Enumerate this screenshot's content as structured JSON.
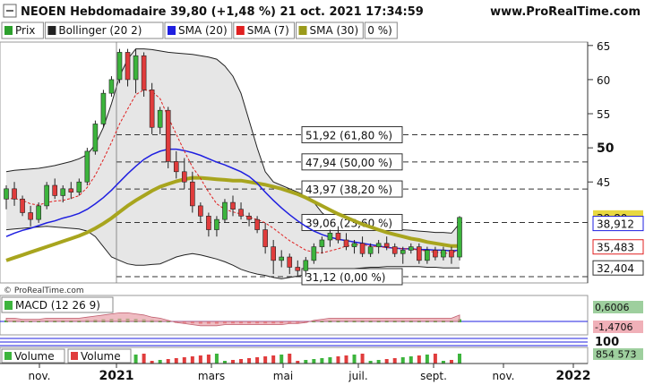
{
  "header": {
    "title": "NEOEN Hebdomadaire 39,80 (+1,48 %) 21 oct. 2021 17:34:59",
    "site": "www.ProRealTime.com",
    "icon": "minus-box-icon"
  },
  "legend": [
    {
      "label": "Prix",
      "color": "#2ca02c"
    },
    {
      "label": "Bollinger (20 2)",
      "color": "#222222"
    },
    {
      "label": "SMA (20)",
      "color": "#1f1fe0"
    },
    {
      "label": "SMA (7)",
      "color": "#e02020"
    },
    {
      "label": "SMA (30)",
      "color": "#9a9a1a"
    }
  ],
  "legend_extra": "0 %)",
  "copyright": "© ProRealTime.com",
  "colors": {
    "up": "#3cb43c",
    "down": "#e03c3c",
    "bollinger": "#222222",
    "bollinger_fill": "#e6e6e6",
    "sma20": "#1f1fe0",
    "sma7": "#e02020",
    "sma30": "#a8a51e",
    "macd_fill": "#e8a0a8",
    "last_price_bg": "#e8d840"
  },
  "chart_data": {
    "type": "candlestick",
    "x_tick_labels": [
      "nov.",
      "2021",
      "mars",
      "mai",
      "juil.",
      "sept.",
      "nov.",
      "2022"
    ],
    "y_tick_labels": [
      "65",
      "60",
      "55",
      "50",
      "45"
    ],
    "ylim": [
      30.2,
      65.5
    ],
    "last_price": "39,80",
    "price_tags": [
      "38,912",
      "35,483",
      "32,404"
    ],
    "fib_levels": [
      {
        "label": "51,92 (61,80 %)",
        "value": 51.92
      },
      {
        "label": "47,94 (50,00 %)",
        "value": 47.94
      },
      {
        "label": "43,97 (38,20 %)",
        "value": 43.97
      },
      {
        "label": "39,06 (23,60 %)",
        "value": 39.06
      },
      {
        "label": "31,12 (0,00 %)",
        "value": 31.12
      }
    ],
    "candles": [
      {
        "o": 42.5,
        "h": 44.5,
        "l": 41.0,
        "c": 44.0
      },
      {
        "o": 44.0,
        "h": 45.0,
        "l": 41.5,
        "c": 42.5
      },
      {
        "o": 42.5,
        "h": 43.0,
        "l": 40.0,
        "c": 40.5
      },
      {
        "o": 40.5,
        "h": 41.5,
        "l": 38.5,
        "c": 39.5
      },
      {
        "o": 39.5,
        "h": 42.0,
        "l": 39.0,
        "c": 41.5
      },
      {
        "o": 41.5,
        "h": 45.0,
        "l": 41.0,
        "c": 44.5
      },
      {
        "o": 44.5,
        "h": 45.5,
        "l": 42.5,
        "c": 43.0
      },
      {
        "o": 43.0,
        "h": 44.5,
        "l": 42.0,
        "c": 44.0
      },
      {
        "o": 44.0,
        "h": 45.0,
        "l": 42.5,
        "c": 43.5
      },
      {
        "o": 43.5,
        "h": 45.5,
        "l": 43.0,
        "c": 45.0
      },
      {
        "o": 45.0,
        "h": 50.0,
        "l": 44.5,
        "c": 49.5
      },
      {
        "o": 49.5,
        "h": 54.0,
        "l": 49.0,
        "c": 53.5
      },
      {
        "o": 53.5,
        "h": 58.5,
        "l": 53.0,
        "c": 58.0
      },
      {
        "o": 58.0,
        "h": 60.5,
        "l": 57.5,
        "c": 60.0
      },
      {
        "o": 60.0,
        "h": 64.5,
        "l": 59.5,
        "c": 64.0
      },
      {
        "o": 64.0,
        "h": 64.5,
        "l": 59.0,
        "c": 60.0
      },
      {
        "o": 60.0,
        "h": 64.5,
        "l": 58.0,
        "c": 63.5
      },
      {
        "o": 63.5,
        "h": 64.0,
        "l": 57.5,
        "c": 58.5
      },
      {
        "o": 58.5,
        "h": 59.5,
        "l": 52.0,
        "c": 53.0
      },
      {
        "o": 53.0,
        "h": 56.0,
        "l": 52.0,
        "c": 55.5
      },
      {
        "o": 55.5,
        "h": 56.0,
        "l": 47.0,
        "c": 48.0
      },
      {
        "o": 48.0,
        "h": 49.5,
        "l": 45.5,
        "c": 46.5
      },
      {
        "o": 46.5,
        "h": 48.5,
        "l": 44.0,
        "c": 45.0
      },
      {
        "o": 45.0,
        "h": 46.5,
        "l": 40.5,
        "c": 41.5
      },
      {
        "o": 41.5,
        "h": 42.0,
        "l": 39.0,
        "c": 40.0
      },
      {
        "o": 40.0,
        "h": 40.5,
        "l": 37.0,
        "c": 38.0
      },
      {
        "o": 38.0,
        "h": 40.0,
        "l": 37.0,
        "c": 39.5
      },
      {
        "o": 39.5,
        "h": 42.5,
        "l": 39.0,
        "c": 42.0
      },
      {
        "o": 42.0,
        "h": 43.0,
        "l": 40.0,
        "c": 41.0
      },
      {
        "o": 41.0,
        "h": 42.0,
        "l": 39.5,
        "c": 40.0
      },
      {
        "o": 40.0,
        "h": 40.5,
        "l": 38.5,
        "c": 39.5
      },
      {
        "o": 39.5,
        "h": 40.0,
        "l": 37.5,
        "c": 38.0
      },
      {
        "o": 38.0,
        "h": 39.0,
        "l": 34.5,
        "c": 35.5
      },
      {
        "o": 35.5,
        "h": 36.5,
        "l": 31.5,
        "c": 33.5
      },
      {
        "o": 33.5,
        "h": 35.0,
        "l": 32.5,
        "c": 34.0
      },
      {
        "o": 34.0,
        "h": 34.5,
        "l": 31.5,
        "c": 32.5
      },
      {
        "o": 32.5,
        "h": 33.5,
        "l": 31.2,
        "c": 32.0
      },
      {
        "o": 32.0,
        "h": 34.0,
        "l": 31.1,
        "c": 33.5
      },
      {
        "o": 33.5,
        "h": 36.0,
        "l": 33.0,
        "c": 35.5
      },
      {
        "o": 35.5,
        "h": 37.0,
        "l": 34.5,
        "c": 36.5
      },
      {
        "o": 36.5,
        "h": 38.0,
        "l": 35.5,
        "c": 37.5
      },
      {
        "o": 37.5,
        "h": 38.5,
        "l": 36.0,
        "c": 36.5
      },
      {
        "o": 36.5,
        "h": 37.5,
        "l": 35.0,
        "c": 35.5
      },
      {
        "o": 35.5,
        "h": 36.5,
        "l": 34.5,
        "c": 36.0
      },
      {
        "o": 36.0,
        "h": 37.0,
        "l": 34.0,
        "c": 34.5
      },
      {
        "o": 34.5,
        "h": 36.0,
        "l": 34.0,
        "c": 35.5
      },
      {
        "o": 35.5,
        "h": 36.5,
        "l": 34.5,
        "c": 36.0
      },
      {
        "o": 36.0,
        "h": 37.0,
        "l": 35.0,
        "c": 35.5
      },
      {
        "o": 35.5,
        "h": 36.0,
        "l": 34.0,
        "c": 34.5
      },
      {
        "o": 34.5,
        "h": 35.5,
        "l": 33.0,
        "c": 35.0
      },
      {
        "o": 35.0,
        "h": 36.0,
        "l": 34.5,
        "c": 35.5
      },
      {
        "o": 35.5,
        "h": 36.0,
        "l": 33.0,
        "c": 33.5
      },
      {
        "o": 33.5,
        "h": 35.5,
        "l": 33.0,
        "c": 35.0
      },
      {
        "o": 35.0,
        "h": 35.5,
        "l": 33.5,
        "c": 34.0
      },
      {
        "o": 34.0,
        "h": 35.5,
        "l": 33.5,
        "c": 35.0
      },
      {
        "o": 35.0,
        "h": 35.5,
        "l": 33.0,
        "c": 34.0
      },
      {
        "o": 34.0,
        "h": 40.0,
        "l": 33.5,
        "c": 39.8
      }
    ],
    "sma7": [
      42.5,
      42.6,
      42.3,
      41.8,
      41.6,
      42.0,
      42.2,
      42.3,
      42.6,
      43.0,
      44.2,
      46.0,
      48.3,
      50.8,
      53.5,
      55.7,
      57.8,
      58.5,
      58.3,
      57.2,
      54.5,
      52.0,
      49.5,
      47.2,
      45.5,
      43.5,
      41.8,
      41.0,
      40.6,
      40.3,
      39.8,
      39.5,
      39.0,
      38.2,
      37.3,
      36.4,
      35.7,
      35.0,
      34.7,
      34.6,
      34.9,
      35.2,
      35.6,
      35.8,
      35.8,
      35.6,
      35.5,
      35.4,
      35.3,
      35.2,
      35.2,
      35.0,
      34.9,
      34.7,
      34.6,
      34.5,
      35.2
    ],
    "sma20": [
      37.0,
      37.5,
      37.9,
      38.2,
      38.6,
      39.0,
      39.3,
      39.7,
      40.0,
      40.4,
      41.0,
      41.8,
      42.7,
      43.8,
      45.0,
      46.2,
      47.3,
      48.3,
      49.0,
      49.5,
      49.8,
      49.8,
      49.6,
      49.3,
      48.9,
      48.4,
      47.9,
      47.5,
      47.0,
      46.5,
      45.8,
      44.8,
      43.5,
      42.3,
      41.2,
      40.2,
      39.3,
      38.5,
      37.8,
      37.3,
      36.9,
      36.6,
      36.4,
      36.2,
      36.0,
      35.8,
      35.6,
      35.4,
      35.3,
      35.2,
      35.2,
      35.1,
      35.1,
      35.0,
      35.0,
      34.9,
      35.0
    ],
    "sma30": [
      33.5,
      33.9,
      34.3,
      34.7,
      35.1,
      35.5,
      35.9,
      36.3,
      36.7,
      37.1,
      37.6,
      38.2,
      38.9,
      39.7,
      40.6,
      41.5,
      42.3,
      43.0,
      43.7,
      44.3,
      44.7,
      45.1,
      45.4,
      45.6,
      45.6,
      45.5,
      45.4,
      45.3,
      45.2,
      45.2,
      45.0,
      44.8,
      44.6,
      44.3,
      44.0,
      43.6,
      43.2,
      42.7,
      42.1,
      41.5,
      40.9,
      40.3,
      39.8,
      39.3,
      38.8,
      38.4,
      38.0,
      37.6,
      37.3,
      37.0,
      36.7,
      36.5,
      36.2,
      36.0,
      35.8,
      35.6,
      35.6
    ],
    "boll_upper": [
      46.5,
      46.7,
      46.8,
      46.9,
      47.0,
      47.2,
      47.4,
      47.7,
      48.0,
      48.4,
      49.0,
      50.5,
      53.0,
      56.5,
      60.5,
      63.0,
      64.5,
      64.5,
      64.4,
      64.2,
      64.0,
      63.9,
      63.8,
      63.7,
      63.5,
      63.3,
      63.0,
      62.0,
      60.5,
      58.0,
      54.0,
      50.0,
      46.5,
      45.0,
      44.5,
      44.0,
      43.5,
      43.0,
      42.0,
      40.5,
      39.5,
      39.0,
      38.7,
      38.5,
      38.4,
      38.3,
      38.2,
      38.1,
      38.0,
      38.0,
      37.9,
      37.8,
      37.7,
      37.6,
      37.6,
      37.5,
      38.9
    ],
    "boll_lower": [
      38.0,
      38.1,
      38.2,
      38.3,
      38.4,
      38.5,
      38.4,
      38.3,
      38.2,
      38.1,
      37.8,
      37.0,
      35.5,
      34.0,
      33.5,
      33.0,
      32.8,
      32.8,
      32.9,
      33.0,
      33.5,
      34.0,
      34.3,
      34.5,
      34.3,
      34.0,
      33.7,
      33.3,
      32.8,
      32.2,
      31.8,
      31.5,
      31.3,
      31.0,
      30.8,
      31.0,
      31.2,
      31.4,
      31.6,
      31.8,
      32.0,
      32.1,
      32.2,
      32.3,
      32.4,
      32.5,
      32.5,
      32.6,
      32.6,
      32.6,
      32.6,
      32.6,
      32.5,
      32.5,
      32.4,
      32.4,
      32.4
    ],
    "macd": {
      "label": "MACD (12 26 9)",
      "values": [
        "0,6006",
        "-1,4706"
      ],
      "histogram": [
        0.3,
        0.3,
        0.2,
        0.2,
        0.2,
        0.3,
        0.3,
        0.3,
        0.3,
        0.3,
        0.4,
        0.5,
        0.6,
        0.7,
        0.8,
        0.8,
        0.7,
        0.6,
        0.4,
        0.3,
        0.1,
        -0.1,
        -0.2,
        -0.3,
        -0.4,
        -0.4,
        -0.4,
        -0.3,
        -0.3,
        -0.3,
        -0.3,
        -0.3,
        -0.3,
        -0.3,
        -0.3,
        -0.2,
        -0.2,
        -0.1,
        0.1,
        0.2,
        0.3,
        0.3,
        0.3,
        0.3,
        0.3,
        0.3,
        0.3,
        0.3,
        0.3,
        0.3,
        0.3,
        0.3,
        0.3,
        0.3,
        0.3,
        0.3,
        0.6
      ]
    },
    "volume": {
      "labels": [
        "Volume",
        "Volume"
      ],
      "value": "854 573",
      "axis_label": "100"
    }
  }
}
